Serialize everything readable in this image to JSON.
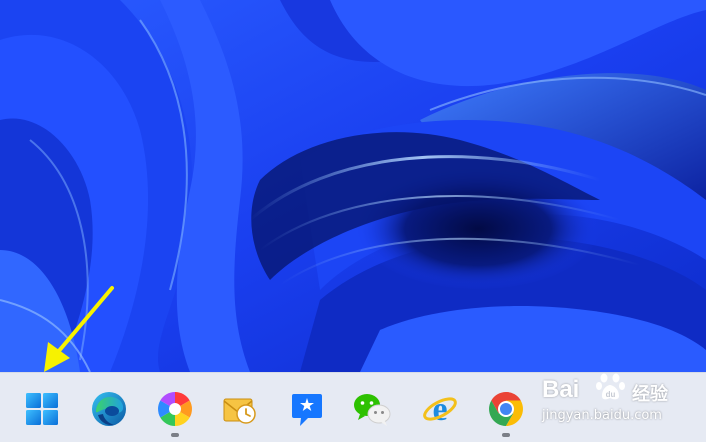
{
  "desktop": {
    "wallpaper": "Windows 11 blue bloom wallpaper",
    "colors": {
      "wallpaper_dark": "#0a1d8f",
      "wallpaper_mid": "#1f4cff",
      "wallpaper_light": "#6fa8ff",
      "taskbar": "#e6eaf3",
      "arrow": "#f5f000"
    }
  },
  "taskbar": {
    "items": [
      {
        "name": "start",
        "icon": "windows-start-icon",
        "running": false
      },
      {
        "name": "edge",
        "icon": "microsoft-edge-icon",
        "running": false
      },
      {
        "name": "color-app",
        "icon": "color-wheel-app-icon",
        "running": true
      },
      {
        "name": "mail",
        "icon": "mail-clock-icon",
        "running": false
      },
      {
        "name": "dingtalk",
        "icon": "dingtalk-icon",
        "running": false
      },
      {
        "name": "wechat",
        "icon": "wechat-icon",
        "running": false
      },
      {
        "name": "internet-explorer",
        "icon": "internet-explorer-icon",
        "running": false
      },
      {
        "name": "chrome",
        "icon": "chrome-icon",
        "running": true
      }
    ]
  },
  "watermark": {
    "brand": "Bai",
    "chinese": "经验",
    "url": "jingyan.baidu.com"
  }
}
